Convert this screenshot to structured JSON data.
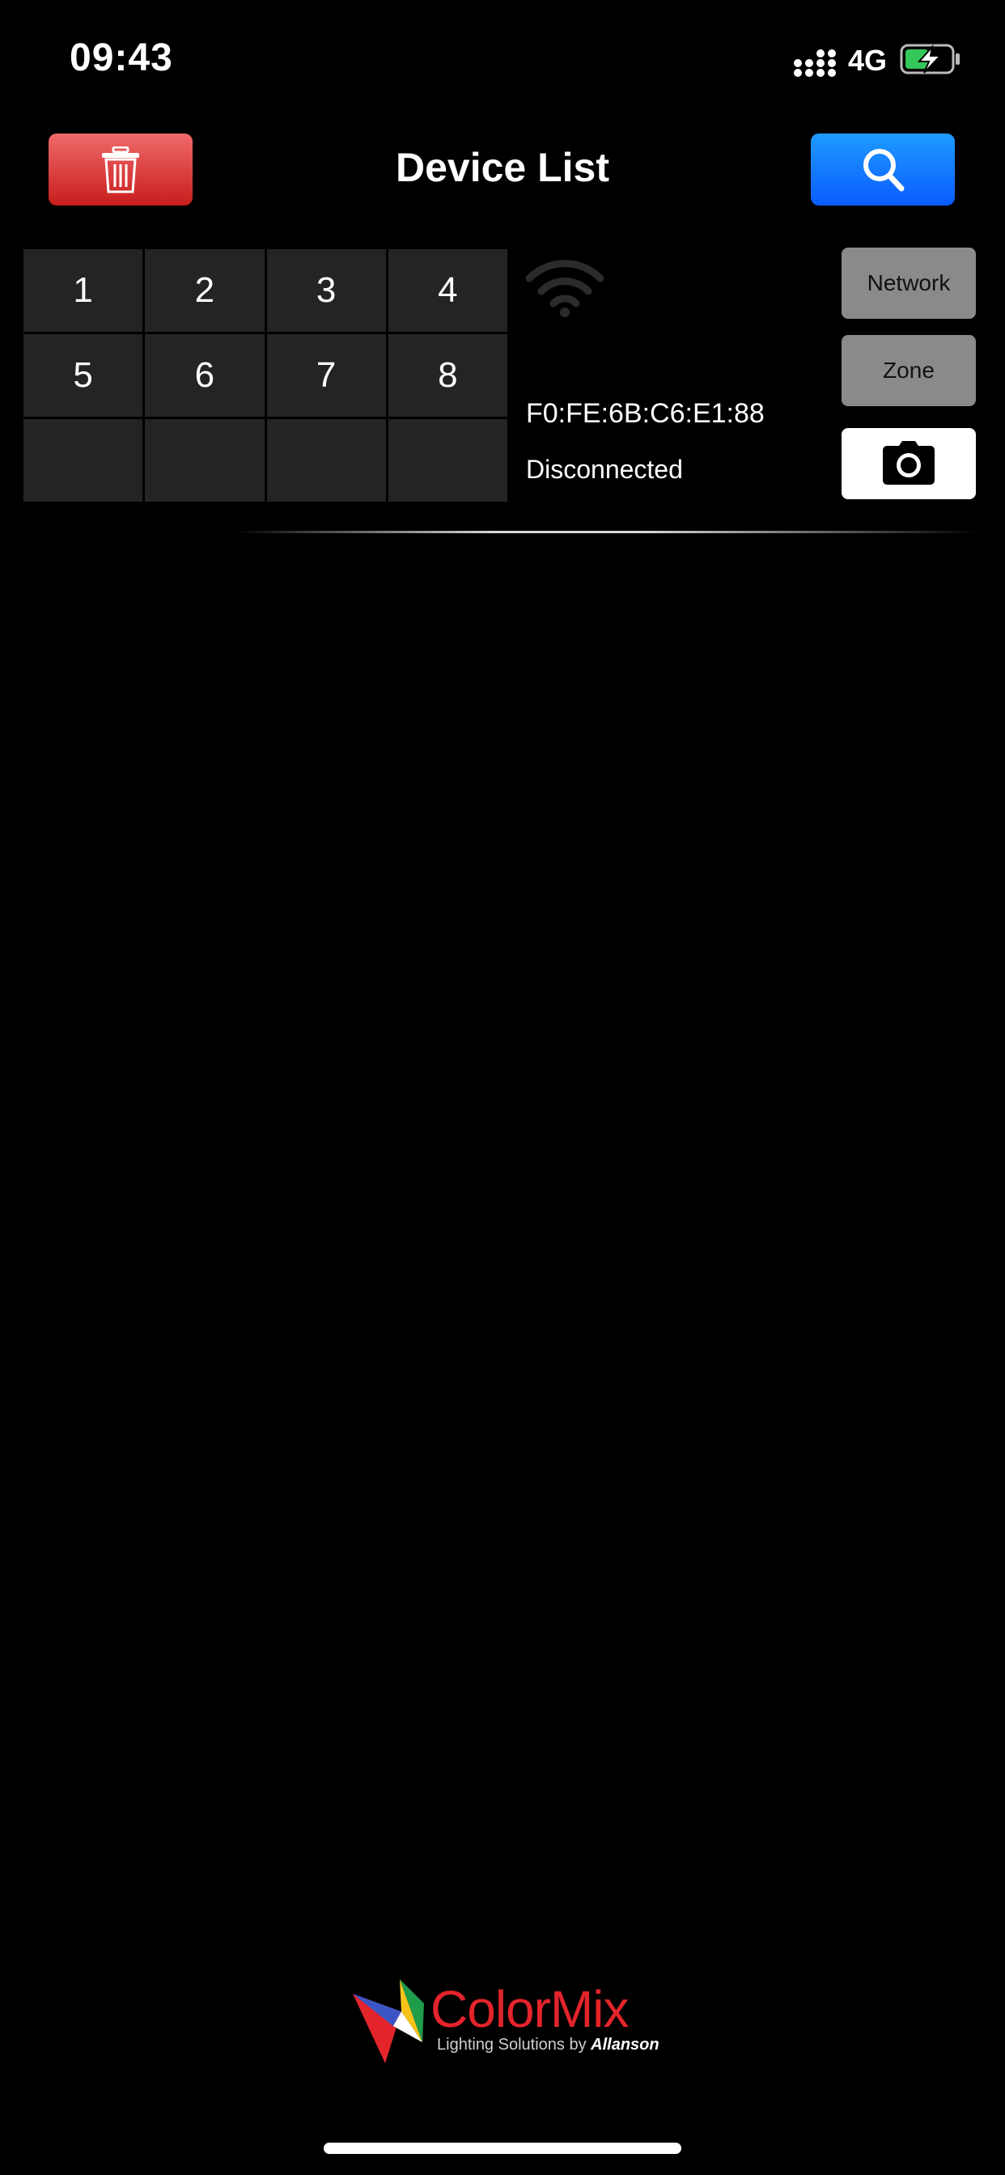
{
  "status_bar": {
    "time": "09:43",
    "network": "4G"
  },
  "header": {
    "title": "Device List"
  },
  "device": {
    "zones": [
      "1",
      "2",
      "3",
      "4",
      "5",
      "6",
      "7",
      "8",
      "",
      "",
      "",
      ""
    ],
    "mac": "F0:FE:6B:C6:E1:88",
    "status": "Disconnected",
    "network_label": "Network",
    "zone_label": "Zone"
  },
  "logo": {
    "name": "ColorMix",
    "tagline": "Lighting Solutions by",
    "brand": "Allanson"
  },
  "colors": {
    "delete": "#d8302f",
    "search": "#0f6dff",
    "logo_text": "#e3242b",
    "cell": "#242424",
    "side_button": "#8a8a8a"
  }
}
